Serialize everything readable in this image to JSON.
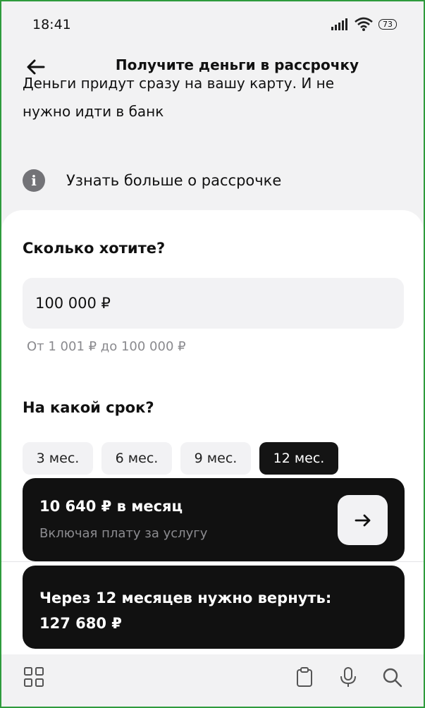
{
  "status_bar": {
    "time": "18:41",
    "battery": "73",
    "icons": [
      "signal-icon",
      "wifi-icon",
      "battery-icon"
    ]
  },
  "header": {
    "title": "Получите деньги в рассрочку",
    "back_icon": "arrow-left-icon"
  },
  "intro": {
    "line1": "Деньги придут сразу на вашу карту. И не",
    "line2": "нужно идти в банк"
  },
  "info_link": {
    "icon": "info-icon",
    "label": "Узнать больше о рассрочке"
  },
  "amount_section": {
    "heading": "Сколько хотите?",
    "value": "100 000 ₽",
    "hint": "От 1 001 ₽ до 100 000 ₽"
  },
  "term_section": {
    "heading": "На какой срок?",
    "options": [
      {
        "label": "3 мес.",
        "selected": false
      },
      {
        "label": "6 мес.",
        "selected": false
      },
      {
        "label": "9 мес.",
        "selected": false
      },
      {
        "label": "12 мес.",
        "selected": true
      }
    ]
  },
  "payment_card": {
    "monthly": "10 640 ₽ в месяц",
    "note": "Включая плату за услугу",
    "button_icon": "arrow-right-icon"
  },
  "return_card": {
    "line1": "Через 12 месяцев нужно вернуть:",
    "line2": "127 680 ₽"
  },
  "bottom_nav": {
    "icons": [
      "grid-icon",
      "clipboard-icon",
      "microphone-icon",
      "search-icon"
    ]
  },
  "colors": {
    "dark_card": "#111111",
    "background": "#f2f2f3",
    "frame_border": "#2e9b3c",
    "hint_text": "#8a8a8e"
  }
}
